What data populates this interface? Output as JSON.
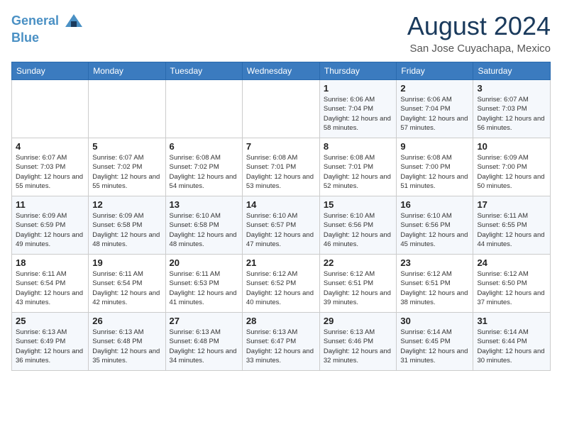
{
  "header": {
    "logo_line1": "General",
    "logo_line2": "Blue",
    "month_year": "August 2024",
    "location": "San Jose Cuyachapa, Mexico"
  },
  "days_of_week": [
    "Sunday",
    "Monday",
    "Tuesday",
    "Wednesday",
    "Thursday",
    "Friday",
    "Saturday"
  ],
  "weeks": [
    [
      {
        "day": "",
        "info": ""
      },
      {
        "day": "",
        "info": ""
      },
      {
        "day": "",
        "info": ""
      },
      {
        "day": "",
        "info": ""
      },
      {
        "day": "1",
        "info": "Sunrise: 6:06 AM\nSunset: 7:04 PM\nDaylight: 12 hours and 58 minutes."
      },
      {
        "day": "2",
        "info": "Sunrise: 6:06 AM\nSunset: 7:04 PM\nDaylight: 12 hours and 57 minutes."
      },
      {
        "day": "3",
        "info": "Sunrise: 6:07 AM\nSunset: 7:03 PM\nDaylight: 12 hours and 56 minutes."
      }
    ],
    [
      {
        "day": "4",
        "info": "Sunrise: 6:07 AM\nSunset: 7:03 PM\nDaylight: 12 hours and 55 minutes."
      },
      {
        "day": "5",
        "info": "Sunrise: 6:07 AM\nSunset: 7:02 PM\nDaylight: 12 hours and 55 minutes."
      },
      {
        "day": "6",
        "info": "Sunrise: 6:08 AM\nSunset: 7:02 PM\nDaylight: 12 hours and 54 minutes."
      },
      {
        "day": "7",
        "info": "Sunrise: 6:08 AM\nSunset: 7:01 PM\nDaylight: 12 hours and 53 minutes."
      },
      {
        "day": "8",
        "info": "Sunrise: 6:08 AM\nSunset: 7:01 PM\nDaylight: 12 hours and 52 minutes."
      },
      {
        "day": "9",
        "info": "Sunrise: 6:08 AM\nSunset: 7:00 PM\nDaylight: 12 hours and 51 minutes."
      },
      {
        "day": "10",
        "info": "Sunrise: 6:09 AM\nSunset: 7:00 PM\nDaylight: 12 hours and 50 minutes."
      }
    ],
    [
      {
        "day": "11",
        "info": "Sunrise: 6:09 AM\nSunset: 6:59 PM\nDaylight: 12 hours and 49 minutes."
      },
      {
        "day": "12",
        "info": "Sunrise: 6:09 AM\nSunset: 6:58 PM\nDaylight: 12 hours and 48 minutes."
      },
      {
        "day": "13",
        "info": "Sunrise: 6:10 AM\nSunset: 6:58 PM\nDaylight: 12 hours and 48 minutes."
      },
      {
        "day": "14",
        "info": "Sunrise: 6:10 AM\nSunset: 6:57 PM\nDaylight: 12 hours and 47 minutes."
      },
      {
        "day": "15",
        "info": "Sunrise: 6:10 AM\nSunset: 6:56 PM\nDaylight: 12 hours and 46 minutes."
      },
      {
        "day": "16",
        "info": "Sunrise: 6:10 AM\nSunset: 6:56 PM\nDaylight: 12 hours and 45 minutes."
      },
      {
        "day": "17",
        "info": "Sunrise: 6:11 AM\nSunset: 6:55 PM\nDaylight: 12 hours and 44 minutes."
      }
    ],
    [
      {
        "day": "18",
        "info": "Sunrise: 6:11 AM\nSunset: 6:54 PM\nDaylight: 12 hours and 43 minutes."
      },
      {
        "day": "19",
        "info": "Sunrise: 6:11 AM\nSunset: 6:54 PM\nDaylight: 12 hours and 42 minutes."
      },
      {
        "day": "20",
        "info": "Sunrise: 6:11 AM\nSunset: 6:53 PM\nDaylight: 12 hours and 41 minutes."
      },
      {
        "day": "21",
        "info": "Sunrise: 6:12 AM\nSunset: 6:52 PM\nDaylight: 12 hours and 40 minutes."
      },
      {
        "day": "22",
        "info": "Sunrise: 6:12 AM\nSunset: 6:51 PM\nDaylight: 12 hours and 39 minutes."
      },
      {
        "day": "23",
        "info": "Sunrise: 6:12 AM\nSunset: 6:51 PM\nDaylight: 12 hours and 38 minutes."
      },
      {
        "day": "24",
        "info": "Sunrise: 6:12 AM\nSunset: 6:50 PM\nDaylight: 12 hours and 37 minutes."
      }
    ],
    [
      {
        "day": "25",
        "info": "Sunrise: 6:13 AM\nSunset: 6:49 PM\nDaylight: 12 hours and 36 minutes."
      },
      {
        "day": "26",
        "info": "Sunrise: 6:13 AM\nSunset: 6:48 PM\nDaylight: 12 hours and 35 minutes."
      },
      {
        "day": "27",
        "info": "Sunrise: 6:13 AM\nSunset: 6:48 PM\nDaylight: 12 hours and 34 minutes."
      },
      {
        "day": "28",
        "info": "Sunrise: 6:13 AM\nSunset: 6:47 PM\nDaylight: 12 hours and 33 minutes."
      },
      {
        "day": "29",
        "info": "Sunrise: 6:13 AM\nSunset: 6:46 PM\nDaylight: 12 hours and 32 minutes."
      },
      {
        "day": "30",
        "info": "Sunrise: 6:14 AM\nSunset: 6:45 PM\nDaylight: 12 hours and 31 minutes."
      },
      {
        "day": "31",
        "info": "Sunrise: 6:14 AM\nSunset: 6:44 PM\nDaylight: 12 hours and 30 minutes."
      }
    ]
  ]
}
